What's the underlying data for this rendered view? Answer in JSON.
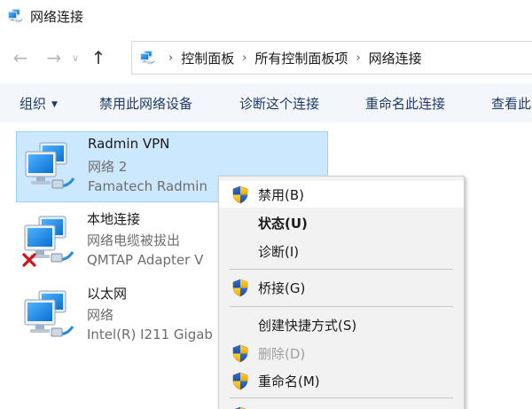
{
  "window": {
    "title": "网络连接"
  },
  "nav": {
    "back_glyph": "←",
    "forward_glyph": "→",
    "dropdown_glyph": "∨",
    "up_glyph": "↑",
    "breadcrumb": [
      "控制面板",
      "所有控制面板项",
      "网络连接"
    ],
    "separator": "›"
  },
  "commands": {
    "organize": "组织",
    "disable_device": "禁用此网络设备",
    "diagnose": "诊断这个连接",
    "rename": "重命名此连接",
    "view": "查看此"
  },
  "connections": [
    {
      "name": "Radmin VPN",
      "status": "网络 2",
      "device": "Famatech Radmin",
      "selected": true,
      "disconnected": false
    },
    {
      "name": "本地连接",
      "status": "网络电缆被拔出",
      "device": "QMTAP Adapter V",
      "selected": false,
      "disconnected": true
    },
    {
      "name": "以太网",
      "status": "网络",
      "device": "Intel(R) I211 Gigab",
      "selected": false,
      "disconnected": false
    }
  ],
  "context_menu": {
    "items": [
      {
        "label": "禁用(B)",
        "shield": true
      },
      {
        "label": "状态(U)",
        "bold": true
      },
      {
        "label": "诊断(I)"
      },
      {
        "label": "桥接(G)",
        "shield": true
      },
      {
        "label": "创建快捷方式(S)"
      },
      {
        "label": "删除(D)",
        "shield": true,
        "disabled": true
      },
      {
        "label": "重命名(M)",
        "shield": true
      }
    ]
  },
  "colors": {
    "selection_bg": "#cce8ff",
    "selection_border": "#99d1ff",
    "command_text": "#1e3a6a",
    "command_bar_bg": "#f3f6fa",
    "menu_bg": "#f2f2f2",
    "disconnected_x": "#d0121b"
  }
}
